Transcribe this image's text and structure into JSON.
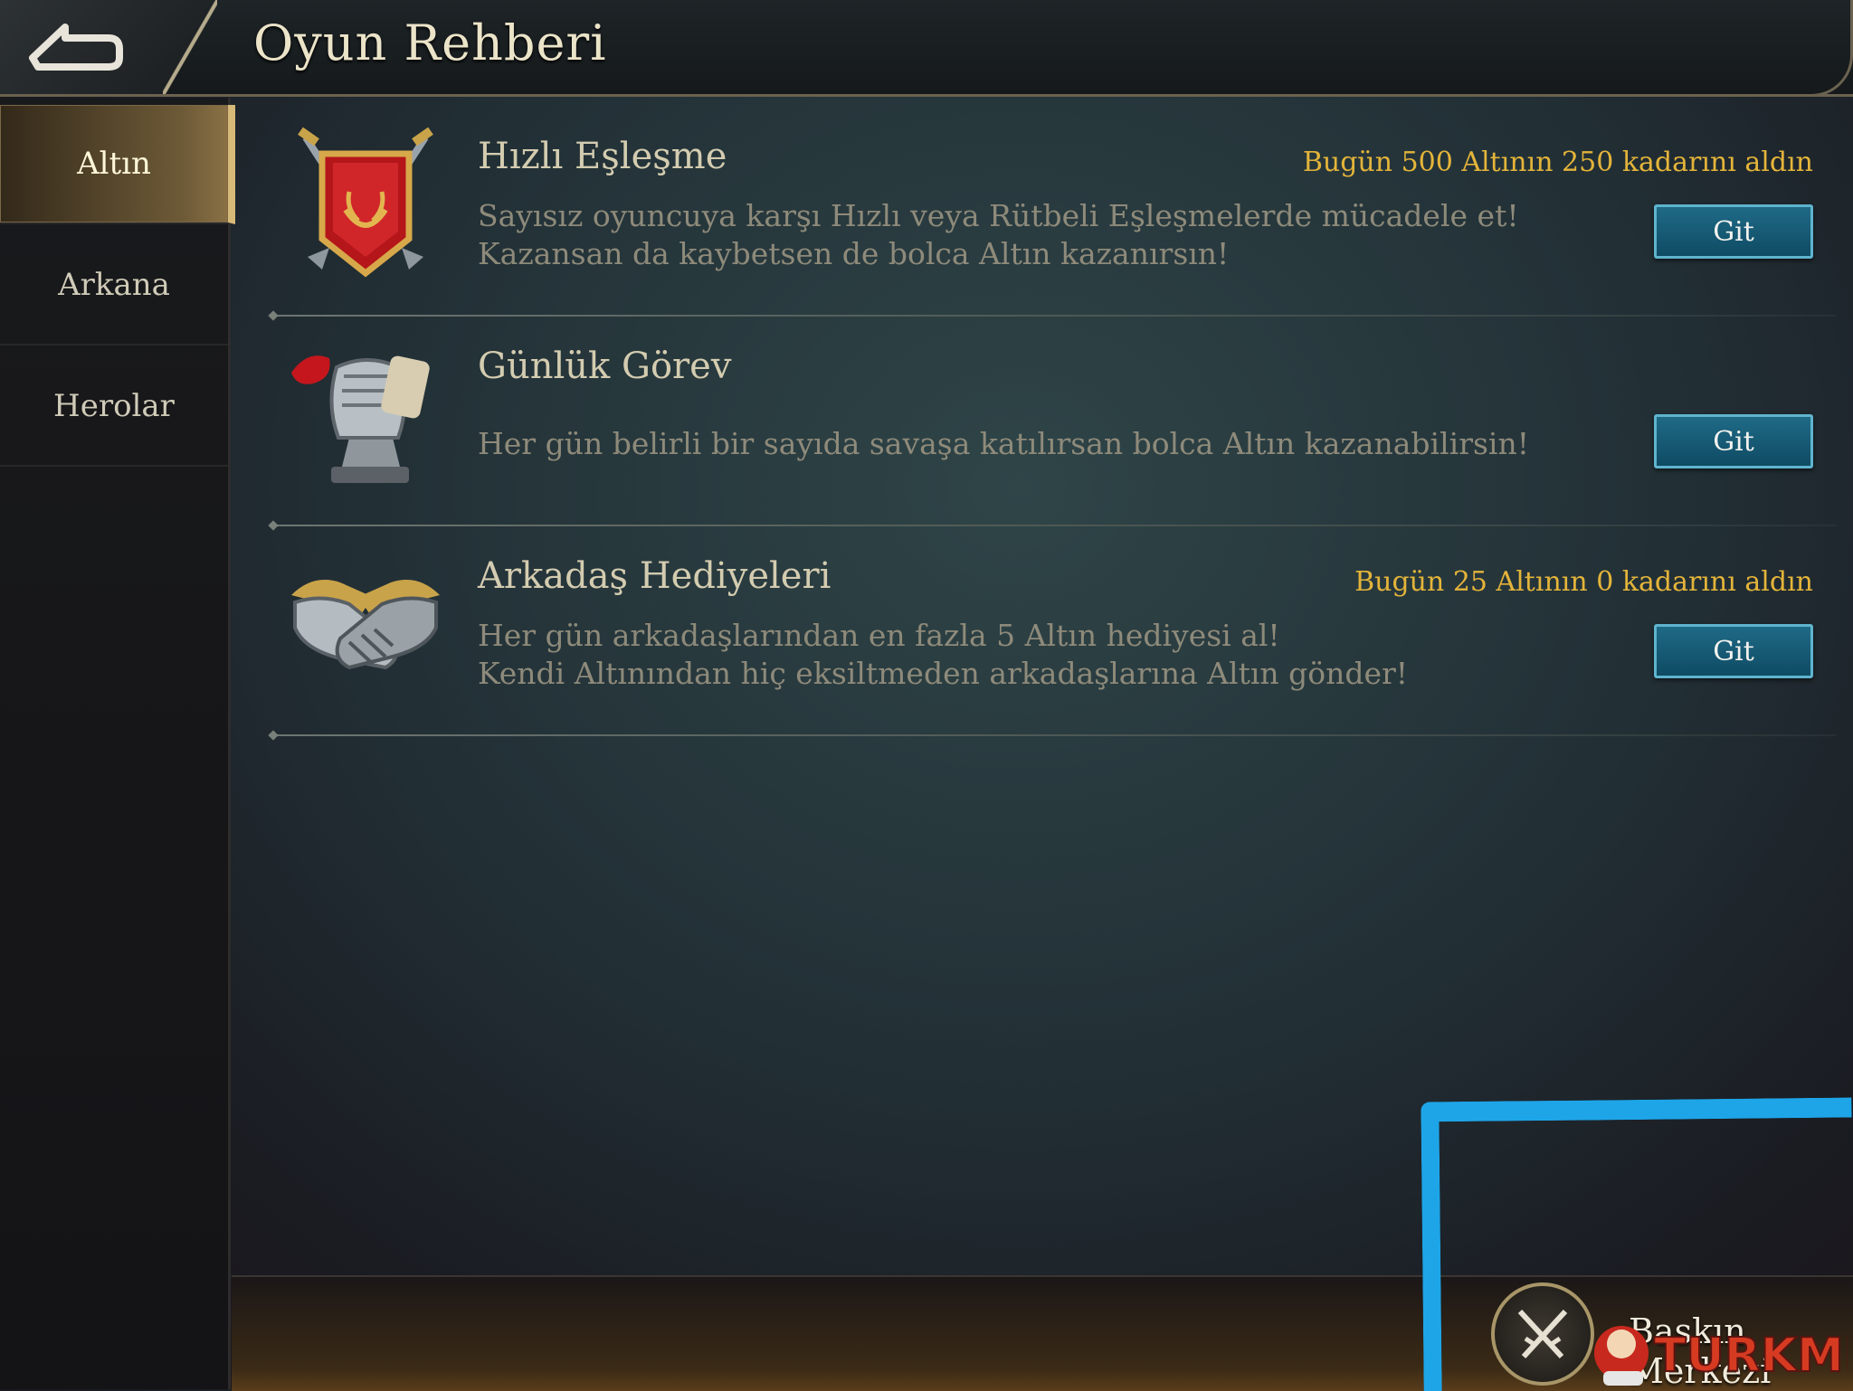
{
  "header": {
    "title": "Oyun Rehberi",
    "back_icon": "back-arrow-icon"
  },
  "sidebar": {
    "items": [
      {
        "label": "Altın",
        "active": true
      },
      {
        "label": "Arkana",
        "active": false
      },
      {
        "label": "Herolar",
        "active": false
      }
    ]
  },
  "guide_items": [
    {
      "icon": "crossed-swords-banner-icon",
      "title": "Hızlı Eşleşme",
      "status": "Bugün 500 Altının 250 kadarını aldın",
      "desc_line1": "Sayısız oyuncuya karşı Hızlı veya Rütbeli Eşleşmelerde mücadele et!",
      "desc_line2": "Kazansan da kaybetsen de bolca Altın kazanırsın!",
      "button": "Git"
    },
    {
      "icon": "gauntlet-scroll-icon",
      "title": "Günlük Görev",
      "status": "",
      "desc_line1": "Her gün belirli bir sayıda savaşa katılırsan bolca Altın kazanabilirsin!",
      "desc_line2": "",
      "button": "Git"
    },
    {
      "icon": "handshake-icon",
      "title": "Arkadaş Hediyeleri",
      "status": "Bugün 25 Altının 0 kadarını aldın",
      "desc_line1": "Her gün arkadaşlarından en fazla 5 Altın hediyesi al!",
      "desc_line2": "Kendi Altınından hiç eksiltmeden arkadaşlarına Altın gönder!",
      "button": "Git"
    }
  ],
  "footer": {
    "hub_label": "Baskın Merkezi",
    "hub_icon": "crossed-swords-icon",
    "watermark": "TURKMMO"
  },
  "colors": {
    "accent_gold": "#e4b43a",
    "button_blue": "#1f6a86",
    "annotation_blue": "#1ea5e8"
  }
}
